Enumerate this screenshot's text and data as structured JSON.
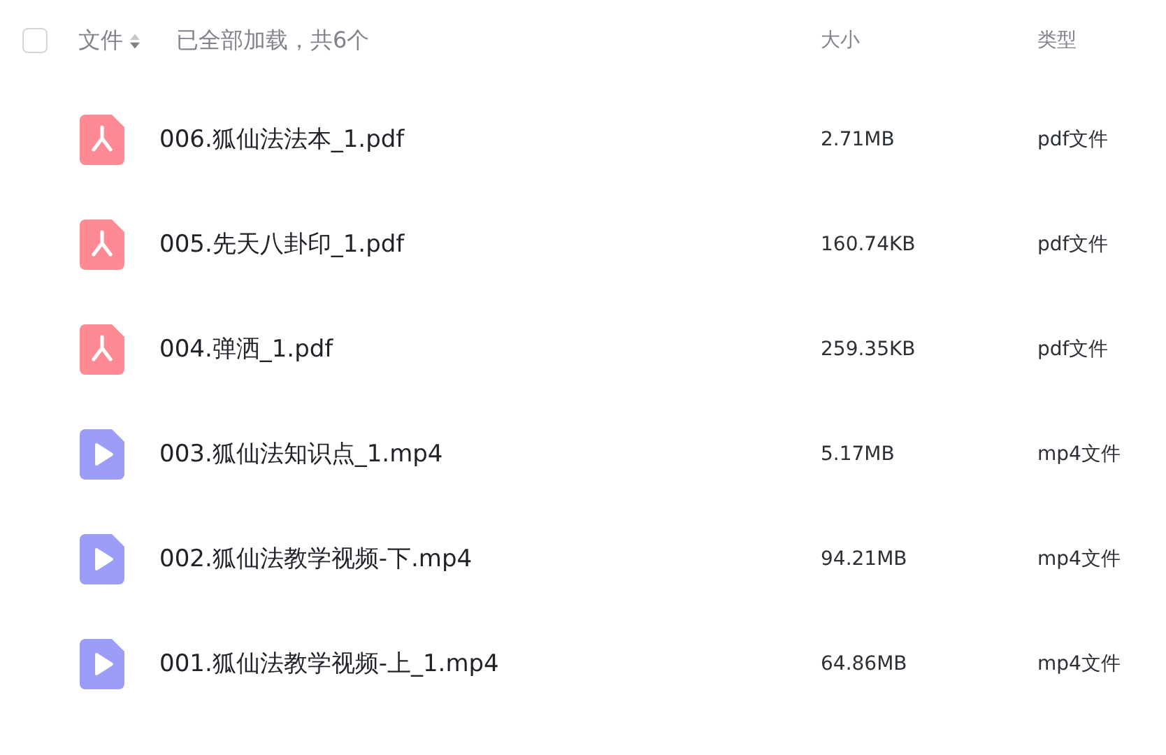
{
  "header": {
    "select_all": {
      "checked": false
    },
    "name_column": "文件",
    "loaded_note": "已全部加载，共6个",
    "size_column": "大小",
    "type_column": "类型"
  },
  "files": [
    {
      "kind": "pdf",
      "name": "006.狐仙法法本_1.pdf",
      "size": "2.71MB",
      "type": "pdf文件"
    },
    {
      "kind": "pdf",
      "name": "005.先天八卦印_1.pdf",
      "size": "160.74KB",
      "type": "pdf文件"
    },
    {
      "kind": "pdf",
      "name": "004.弹洒_1.pdf",
      "size": "259.35KB",
      "type": "pdf文件"
    },
    {
      "kind": "video",
      "name": "003.狐仙法知识点_1.mp4",
      "size": "5.17MB",
      "type": "mp4文件"
    },
    {
      "kind": "video",
      "name": "002.狐仙法教学视频-下.mp4",
      "size": "94.21MB",
      "type": "mp4文件"
    },
    {
      "kind": "video",
      "name": "001.狐仙法教学视频-上_1.mp4",
      "size": "64.86MB",
      "type": "mp4文件"
    }
  ]
}
